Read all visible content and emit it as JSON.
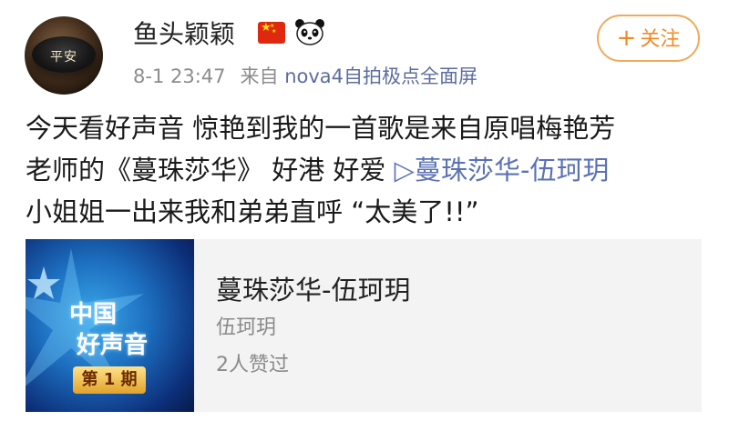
{
  "user": {
    "name": "鱼头颖颖",
    "avatar_text": "平安",
    "badges": [
      "china-flag-icon",
      "panda-icon"
    ]
  },
  "meta": {
    "time": "8-1 23:47",
    "source_prefix": "来自",
    "source": "nova4自拍极点全面屏"
  },
  "follow_button": {
    "icon": "+",
    "label": "关注"
  },
  "post": {
    "line1": "今天看好声音 惊艳到我的一首歌是来自原唱梅艳芳",
    "line2_text": "老师的《蔓珠莎华》 好港 好爱 ",
    "link_text": "▷蔓珠莎华-伍珂玥",
    "line3": "小姐姐一出来我和弟弟直呼 “太美了!!”"
  },
  "music_card": {
    "cover_logo_line1": "中国",
    "cover_logo_line1b": "好声音",
    "cover_issue": "第 1 期",
    "title": "蔓珠莎华-伍珂玥",
    "artist": "伍珂玥",
    "likes": "2人赞过"
  },
  "colors": {
    "accent": "#f08a24",
    "link": "#5a72b6",
    "meta": "#8c8c8c"
  }
}
